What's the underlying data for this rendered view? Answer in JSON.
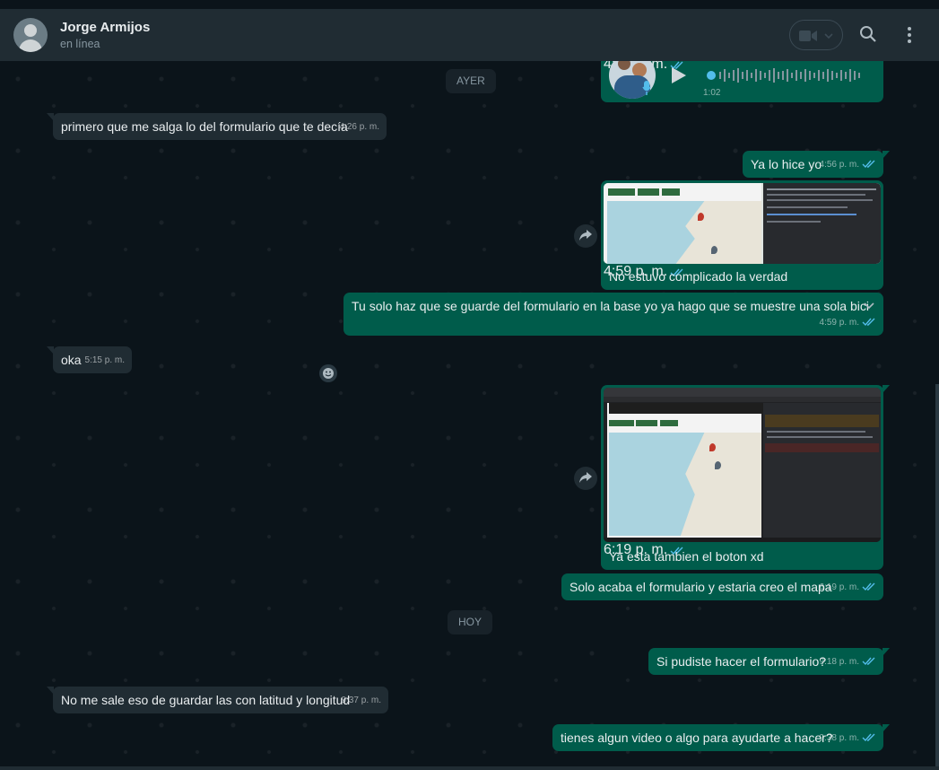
{
  "header": {
    "contact_name": "Jorge Armijos",
    "status": "en línea",
    "icons": [
      "video-call-icon",
      "chevron-down-icon",
      "search-icon",
      "menu-icon"
    ]
  },
  "chat": {
    "date_yesterday": "AYER",
    "date_today": "HOY",
    "audio": {
      "duration": "1:02",
      "time": "4:00 p. m."
    },
    "messages": [
      {
        "text": "primero que me salga lo del formulario que te decía",
        "time": "4:26 p. m."
      },
      {
        "text": "Ya lo hice yo",
        "time": "4:56 p. m."
      },
      {
        "text": "No estuvo complicado la verdad",
        "time": "4:59 p. m."
      },
      {
        "text": "Tu solo haz que se guarde del formulario en la base yo ya hago que se muestre una sola bici",
        "time": "4:59 p. m."
      },
      {
        "text": "oka",
        "time": "5:15 p. m."
      },
      {
        "text": "Ya esta tambien el boton xd",
        "time": "6:19 p. m."
      },
      {
        "text": "Solo acaba el formulario y estaria creo el mapa",
        "time": "6:19 p. m."
      },
      {
        "text": "Si pudiste hacer el formulario?",
        "time": "9:18 p. m."
      },
      {
        "text": "No me sale eso de guardar las con latitud y longitud",
        "time": "9:37 p. m."
      },
      {
        "text": "tienes algun video o algo para ayudarte a hacer?",
        "time": "9:38 p. m."
      }
    ]
  },
  "colors": {
    "incoming": "#202c33",
    "outgoing": "#005c4b",
    "background": "#0b141a",
    "read_ticks": "#53bdeb"
  }
}
